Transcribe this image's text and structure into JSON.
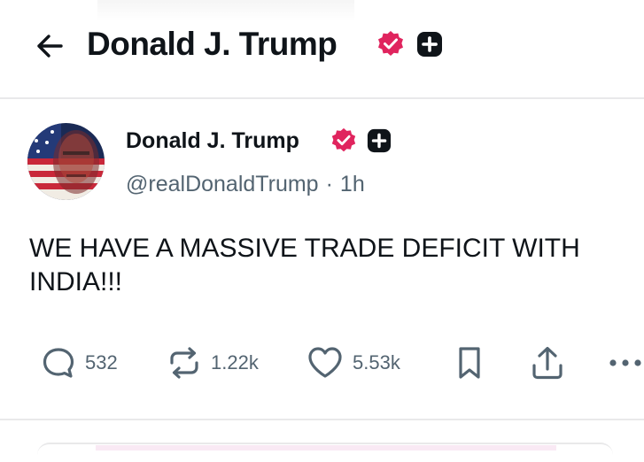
{
  "header": {
    "back_label": "Back",
    "title": "Donald J. Trump"
  },
  "post": {
    "author_name": "Donald J. Trump",
    "handle": "@realDonaldTrump",
    "separator": "·",
    "time": "1h",
    "text": "WE HAVE A MASSIVE TRADE DEFICIT WITH INDIA!!!",
    "stats": {
      "replies": "532",
      "reposts": "1.22k",
      "likes": "5.53k"
    }
  },
  "icons": {
    "back": "arrow-left-icon",
    "verified": "verified-badge-icon",
    "plus_badge": "plus-square-icon",
    "reply": "comment-bubble-icon",
    "repost": "repost-arrows-icon",
    "like": "heart-icon",
    "bookmark": "bookmark-icon",
    "share": "share-upload-icon",
    "more": "more-dots-icon"
  },
  "colors": {
    "text_primary": "#0f1419",
    "text_secondary": "#536471",
    "verified_badge": "#e0245e",
    "divider": "#e9e9ea",
    "icon": "#536471"
  }
}
